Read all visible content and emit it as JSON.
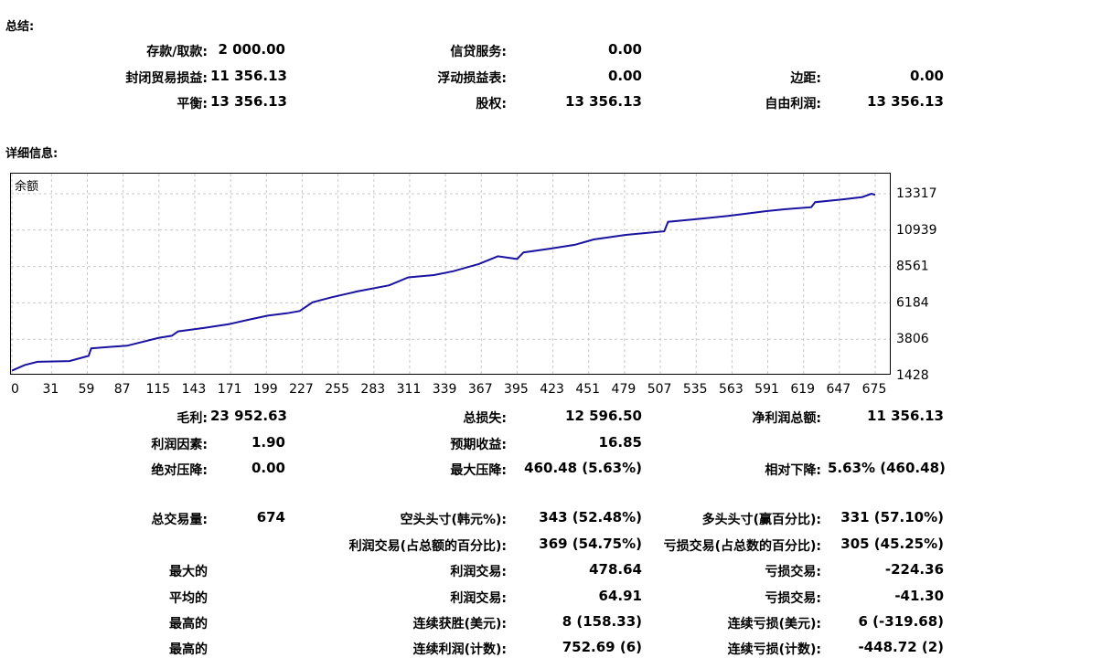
{
  "summary": {
    "title": "总结:",
    "rows": [
      [
        {
          "label": "存款/取款:",
          "value": "2 000.00"
        },
        {
          "label": "信贷服务:",
          "value": "0.00"
        },
        {
          "label": "",
          "value": ""
        }
      ],
      [
        {
          "label": "封闭贸易损益:",
          "value": "11 356.13"
        },
        {
          "label": "浮动损益表:",
          "value": "0.00"
        },
        {
          "label": "边距:",
          "value": "0.00"
        }
      ],
      [
        {
          "label": "平衡:",
          "value": "13 356.13"
        },
        {
          "label": "股权:",
          "value": "13 356.13"
        },
        {
          "label": "自由利润:",
          "value": "13 356.13"
        }
      ]
    ]
  },
  "details": {
    "title": "详细信息:",
    "rows": [
      [
        {
          "label": "毛利:",
          "value": "23 952.63"
        },
        {
          "label": "总损失:",
          "value": "12 596.50"
        },
        {
          "label": "净利润总额:",
          "value": "11 356.13"
        }
      ],
      [
        {
          "label": "利润因素:",
          "value": "1.90"
        },
        {
          "label": "预期收益:",
          "value": "16.85"
        },
        {
          "label": "",
          "value": ""
        }
      ],
      [
        {
          "label": "绝对压降:",
          "value": "0.00"
        },
        {
          "label": "最大压降:",
          "value": "460.48 (5.63%)"
        },
        {
          "label": "相对下降:",
          "value": "5.63% (460.48)"
        }
      ]
    ]
  },
  "trades": {
    "rows": [
      [
        {
          "label": "总交易量:",
          "value": "674"
        },
        {
          "label": "空头头寸(韩元%):",
          "value": "343 (52.48%)"
        },
        {
          "label": "多头头寸(赢百分比):",
          "value": "331 (57.10%)"
        }
      ],
      [
        {
          "label": "",
          "value": ""
        },
        {
          "label": "利润交易(占总额的百分比):",
          "value": "369 (54.75%)"
        },
        {
          "label": "亏损交易(占总数的百分比):",
          "value": "305 (45.25%)"
        }
      ],
      [
        {
          "label": "最大的",
          "value": ""
        },
        {
          "label": "利润交易:",
          "value": "478.64"
        },
        {
          "label": "亏损交易:",
          "value": "-224.36"
        }
      ],
      [
        {
          "label": "平均的",
          "value": ""
        },
        {
          "label": "利润交易:",
          "value": "64.91"
        },
        {
          "label": "亏损交易:",
          "value": "-41.30"
        }
      ],
      [
        {
          "label": "最高的",
          "value": ""
        },
        {
          "label": "连续获胜(美元):",
          "value": "8 (158.33)"
        },
        {
          "label": "连续亏损(美元):",
          "value": "6 (-319.68)"
        }
      ],
      [
        {
          "label": "最高的",
          "value": ""
        },
        {
          "label": "连续利润(计数):",
          "value": "752.69 (6)"
        },
        {
          "label": "连续亏损(计数):",
          "value": "-448.72 (2)"
        }
      ]
    ]
  },
  "chart_data": {
    "type": "line",
    "title": "余额",
    "xlabel": "",
    "ylabel": "",
    "x_ticks": [
      0,
      31,
      59,
      87,
      115,
      143,
      171,
      199,
      227,
      255,
      283,
      311,
      339,
      367,
      395,
      423,
      451,
      479,
      507,
      535,
      563,
      591,
      619,
      647,
      675
    ],
    "y_ticks": [
      1428,
      3806,
      6184,
      8561,
      10939,
      13317
    ],
    "xlim": [
      0,
      685
    ],
    "ylim": [
      1428,
      13500
    ],
    "grid": true,
    "line_color": "#1a12a0",
    "series": [
      {
        "x": [
          0,
          10,
          20,
          45,
          60,
          62,
          75,
          90,
          115,
          125,
          130,
          150,
          170,
          185,
          200,
          215,
          225,
          235,
          250,
          270,
          295,
          310,
          330,
          345,
          365,
          380,
          395,
          400,
          420,
          440,
          455,
          480,
          510,
          513,
          540,
          560,
          590,
          605,
          625,
          628,
          650,
          665,
          672,
          675
        ],
        "y": [
          1750,
          2120,
          2330,
          2380,
          2720,
          3210,
          3300,
          3380,
          3900,
          4030,
          4320,
          4540,
          4800,
          5080,
          5350,
          5500,
          5650,
          6220,
          6550,
          6930,
          7330,
          7850,
          8000,
          8250,
          8720,
          9230,
          9050,
          9480,
          9720,
          9980,
          10330,
          10630,
          10860,
          11480,
          11700,
          11870,
          12180,
          12310,
          12440,
          12770,
          12950,
          13100,
          13317,
          13250
        ]
      }
    ]
  }
}
